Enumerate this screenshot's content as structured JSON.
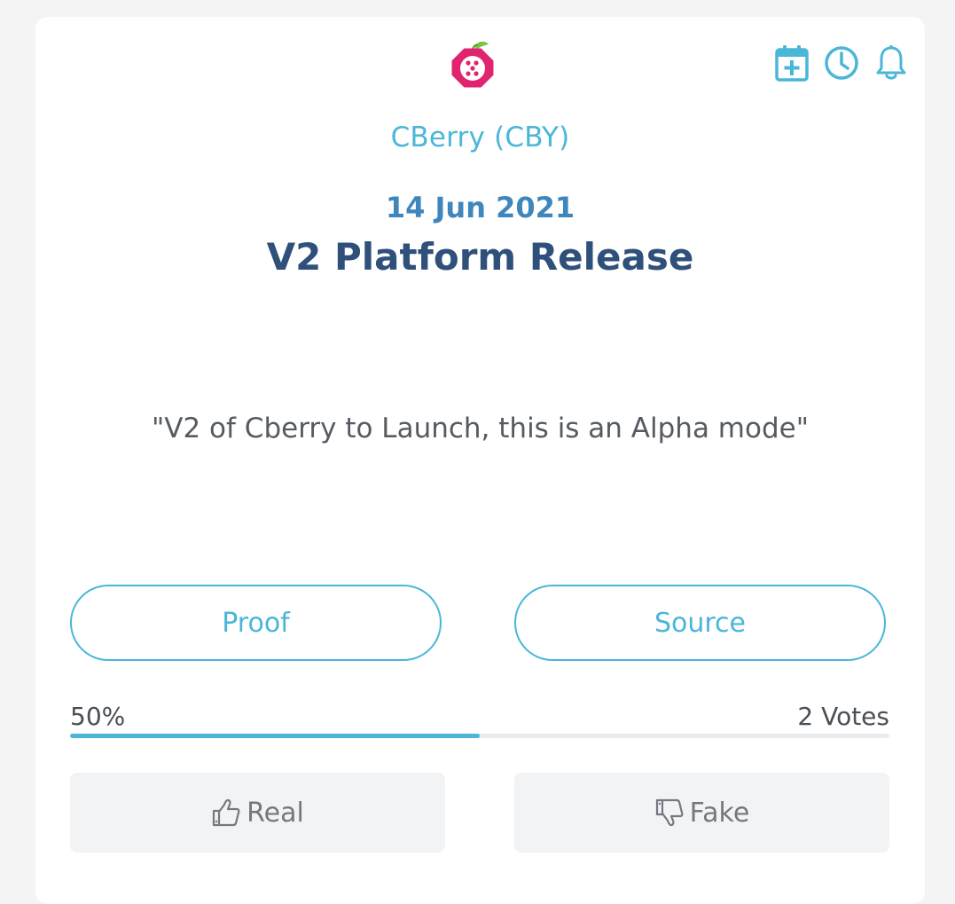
{
  "event": {
    "coin_name": "CBerry (CBY)",
    "date": "14 Jun 2021",
    "title": "V2 Platform Release",
    "quote": "\"V2 of Cberry to Launch, this is an Alpha mode\""
  },
  "actions": {
    "proof_label": "Proof",
    "source_label": "Source"
  },
  "votes": {
    "percent_label": "50%",
    "percent_value": 50,
    "count_label": "2 Votes",
    "real_label": "Real",
    "fake_label": "Fake"
  },
  "icons": {
    "logo": "strawberry-logo-icon",
    "add_calendar": "calendar-plus-icon",
    "clock": "clock-icon",
    "bell": "bell-icon",
    "thumb_up": "thumbs-up-icon",
    "thumb_down": "thumbs-down-icon"
  },
  "colors": {
    "accent": "#4ab6d8",
    "date": "#3f86bd",
    "title": "#2f507a",
    "logo": "#e0246f"
  }
}
